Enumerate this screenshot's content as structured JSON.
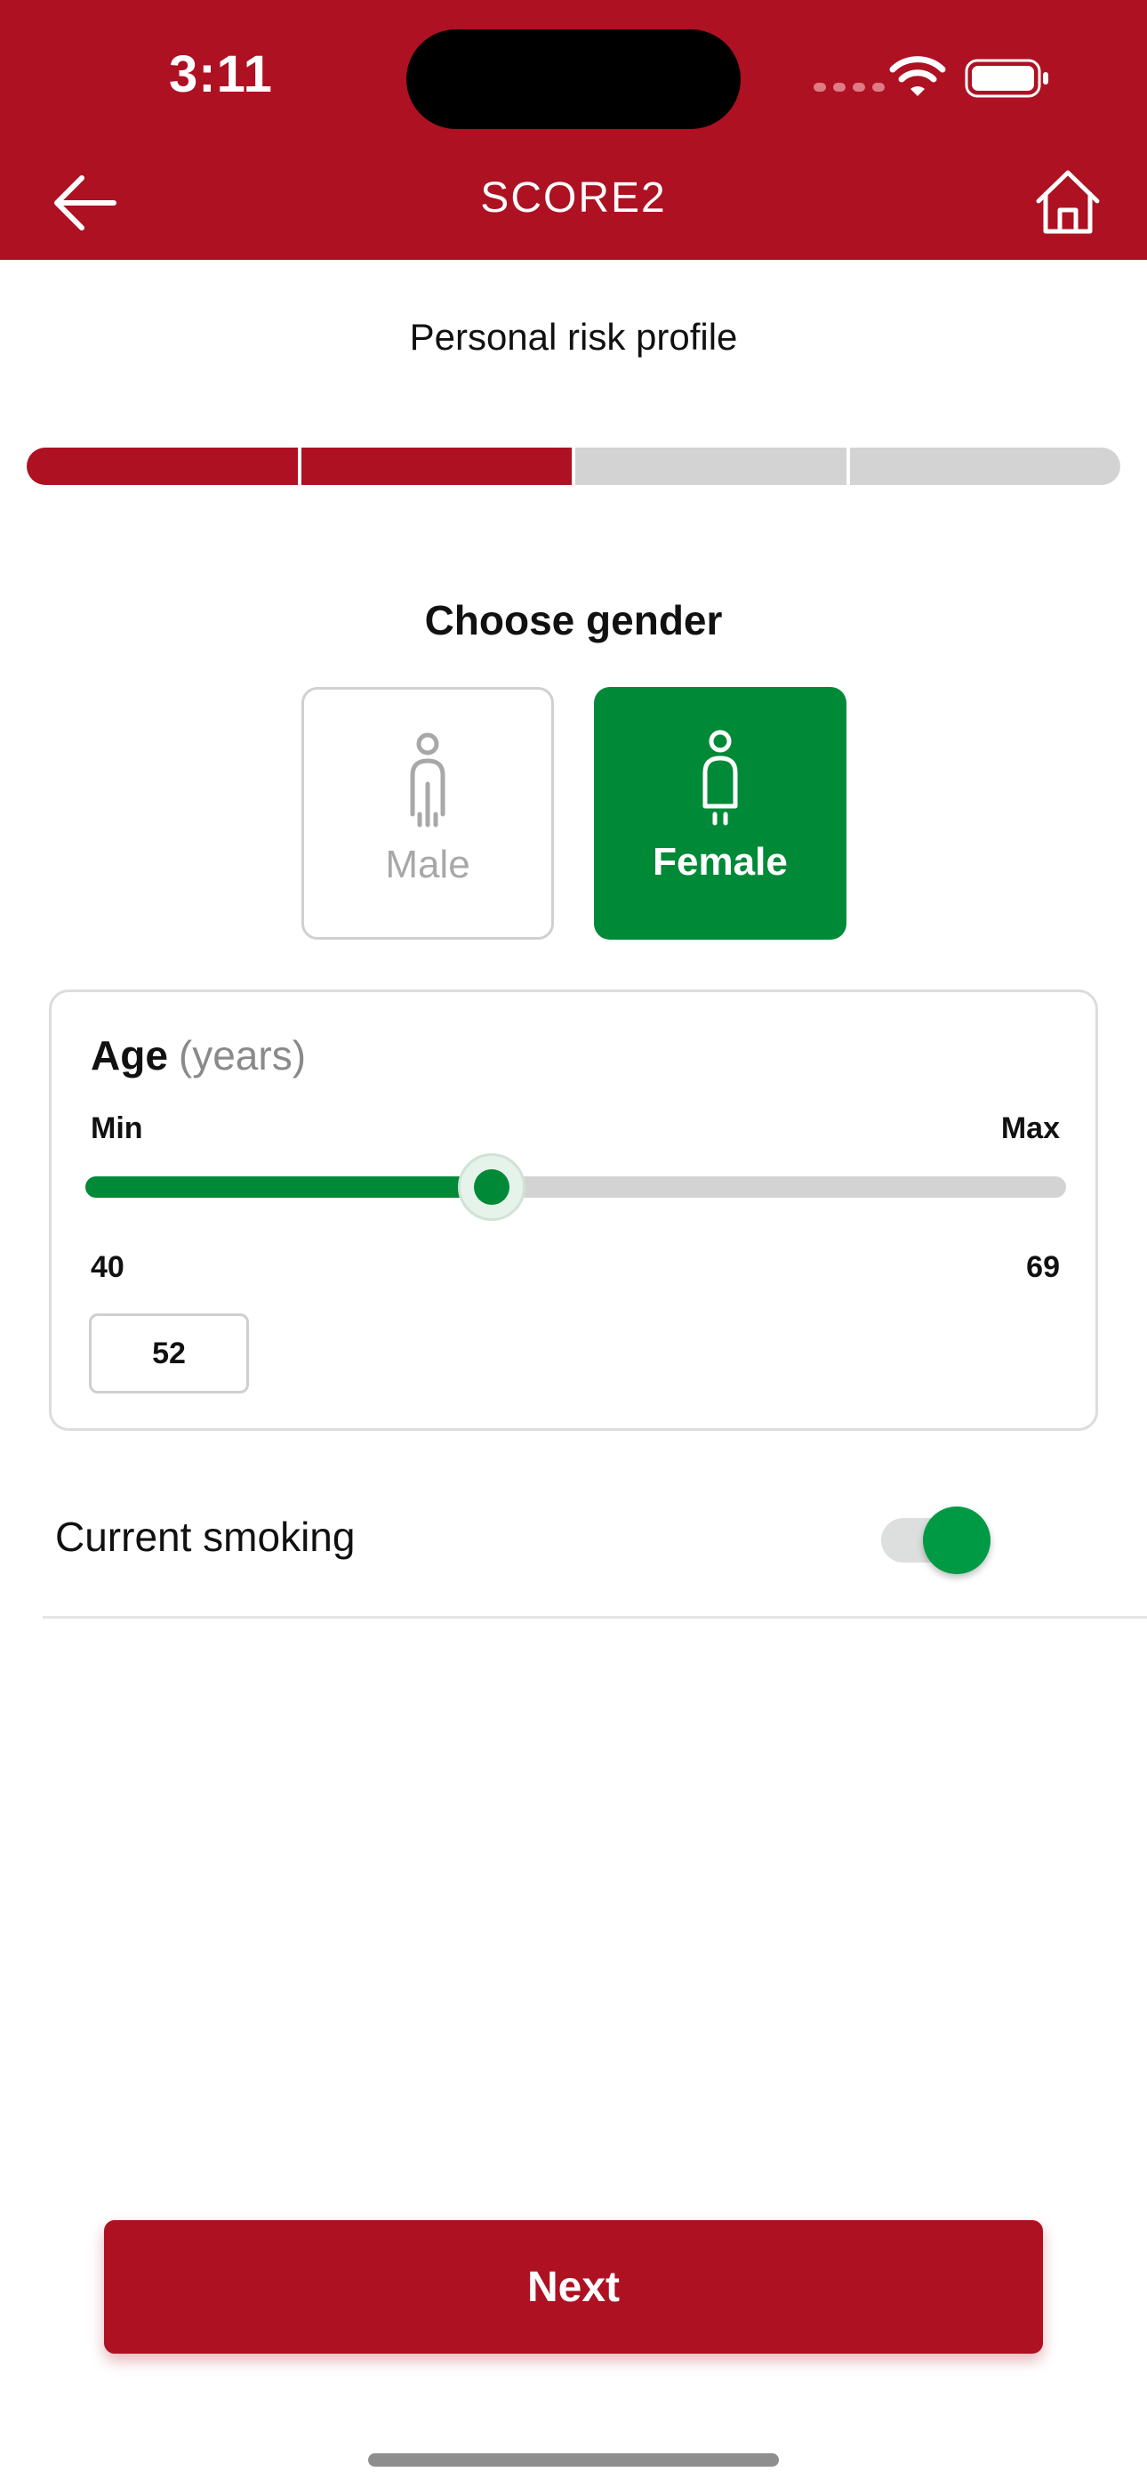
{
  "status_bar": {
    "time": "3:11"
  },
  "header": {
    "title": "SCORE2"
  },
  "subtitle": "Personal risk profile",
  "progress": {
    "current_step": 2,
    "total_steps": 4
  },
  "gender": {
    "heading": "Choose gender",
    "options": [
      {
        "label": "Male",
        "selected": false
      },
      {
        "label": "Female",
        "selected": true
      }
    ]
  },
  "age": {
    "title": "Age",
    "unit": "(years)",
    "min_label": "Min",
    "max_label": "Max",
    "min_value": "40",
    "max_value": "69",
    "value": "52"
  },
  "smoking": {
    "label": "Current smoking",
    "enabled": true
  },
  "next_button": "Next",
  "colors": {
    "brand_red": "#ad1122",
    "accent_green": "#008a38",
    "track_gray": "#d3d3d3"
  },
  "icons": [
    "arrow-left-icon",
    "home-icon",
    "wifi-icon",
    "battery-icon",
    "male-icon",
    "female-icon"
  ]
}
